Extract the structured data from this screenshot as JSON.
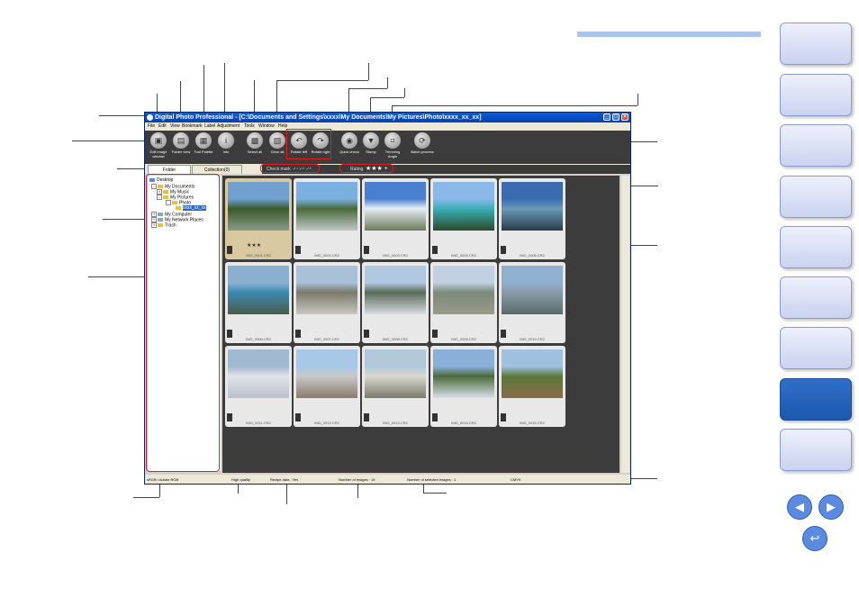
{
  "window": {
    "title": "Digital Photo Professional - [C:\\Documents and Settings\\xxxx\\My Documents\\My Pictures\\Photo\\xxxx_xx_xx]",
    "menus": [
      "File",
      "Edit",
      "View",
      "Bookmark",
      "Label",
      "Adjustment",
      "Tools",
      "Window",
      "Help"
    ],
    "toolbar": [
      {
        "label": "Edit image window",
        "icon": "edit-image-icon"
      },
      {
        "label": "Folder view",
        "icon": "folder-view-icon"
      },
      {
        "label": "Tool Palette",
        "icon": "tool-palette-icon"
      },
      {
        "label": "Info",
        "icon": "info-icon"
      },
      {
        "label": "Select all",
        "icon": "select-all-icon"
      },
      {
        "label": "Clear all",
        "icon": "clear-all-icon"
      },
      {
        "label": "Rotate left",
        "icon": "rotate-left-icon"
      },
      {
        "label": "Rotate right",
        "icon": "rotate-right-icon"
      },
      {
        "label": "Quick check",
        "icon": "quick-check-icon"
      },
      {
        "label": "Stamp",
        "icon": "stamp-icon"
      },
      {
        "label": "Trimming Angle",
        "icon": "trimming-icon"
      },
      {
        "label": "Batch process",
        "icon": "batch-process-icon"
      }
    ],
    "tabs": {
      "folder": "Folder",
      "collection": "Collection(0)"
    },
    "filter": {
      "check_mark": "Check mark",
      "rating": "Rating"
    },
    "tree": [
      {
        "label": "Desktop",
        "level": 0
      },
      {
        "label": "My Documents",
        "level": 1
      },
      {
        "label": "My Music",
        "level": 2
      },
      {
        "label": "My Pictures",
        "level": 2
      },
      {
        "label": "Photo",
        "level": 3
      },
      {
        "label": "xxxx_xx_xx",
        "level": 4,
        "selected": true
      },
      {
        "label": "My Computer",
        "level": 1
      },
      {
        "label": "My Network Places",
        "level": 1
      },
      {
        "label": "Trash",
        "level": 1
      }
    ],
    "images": [
      {
        "name": "IMG_0001.CR2",
        "rating": 3,
        "selected": true
      },
      {
        "name": "IMG_0002.CR2"
      },
      {
        "name": "IMG_0003.CR2"
      },
      {
        "name": "IMG_0004.CR2"
      },
      {
        "name": "IMG_0005.CR2"
      },
      {
        "name": "IMG_0006.CR2"
      },
      {
        "name": "IMG_0007.CR2"
      },
      {
        "name": "IMG_0008.CR2"
      },
      {
        "name": "IMG_0009.CR2"
      },
      {
        "name": "IMG_0010.CR2"
      },
      {
        "name": "IMG_0011.CR2"
      },
      {
        "name": "IMG_0012.CR2"
      },
      {
        "name": "IMG_0013.CR2"
      },
      {
        "name": "IMG_0014.CR2"
      },
      {
        "name": "IMG_0015.CR2"
      }
    ],
    "status": {
      "color_space": "sRGB / Adobe RGB",
      "quality": "High quality",
      "recipe": "Recipe data : Yes",
      "num_images": "Number of images : 15",
      "num_selected": "Number of selected images : 1",
      "cmyk": "CMYK"
    }
  },
  "colors": {
    "accent": "#2f6fc8",
    "highlight": "#e02020",
    "toolbar_bg": "#3c3c3c"
  }
}
